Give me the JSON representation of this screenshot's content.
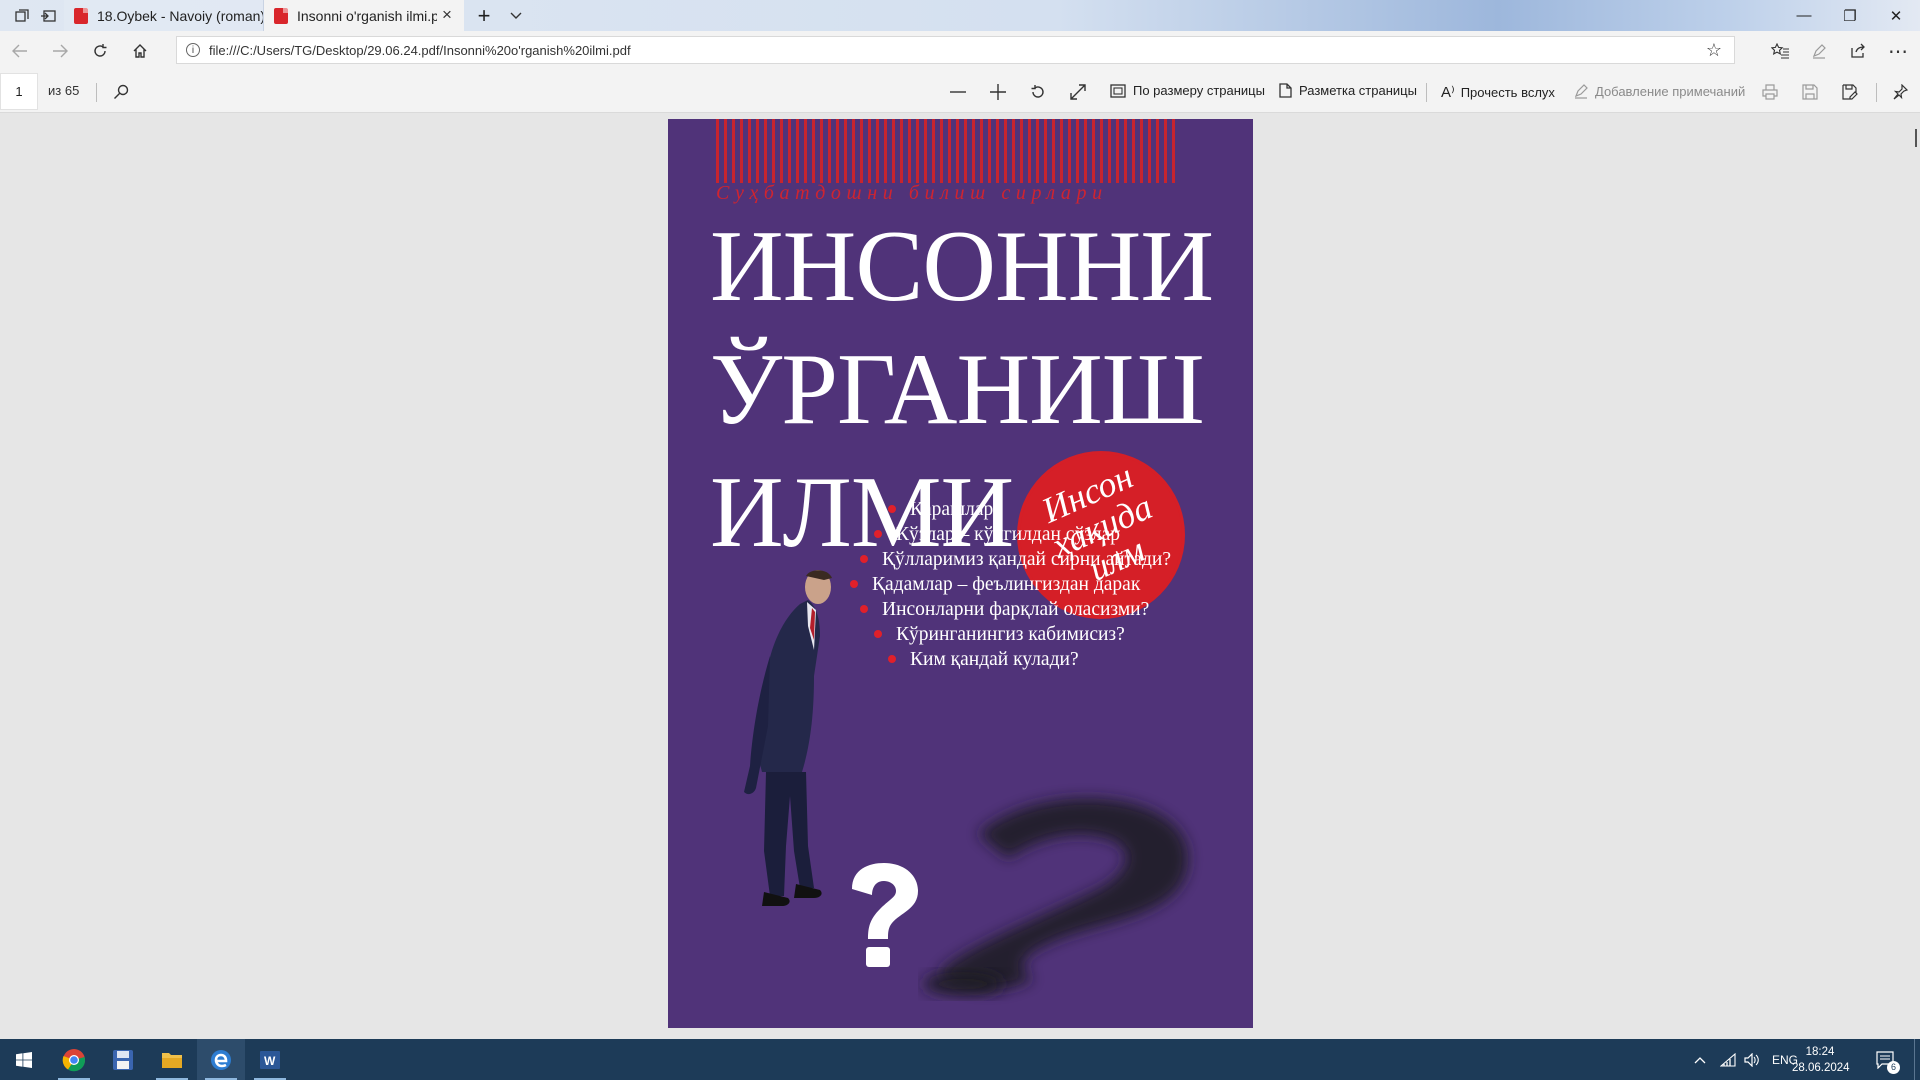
{
  "tabs": [
    {
      "title": "18.Oybek - Navoiy (roman)",
      "icon": "pdf-icon",
      "active": false
    },
    {
      "title": "Insonni o'rganish ilmi.pdf",
      "icon": "pdf-icon",
      "active": true
    }
  ],
  "tab_strip": {
    "new_tab_icon": "+",
    "tab_list_icon": "chevron-down",
    "close_icon": "×"
  },
  "window_controls": {
    "minimize": "—",
    "restore": "❐",
    "close": "✕"
  },
  "address_bar": {
    "url": "file:///C:/Users/TG/Desktop/29.06.24.pdf/Insonni%20o'rganish%20ilmi.pdf",
    "info_icon": "i"
  },
  "pdf_toolbar": {
    "page_current": "1",
    "page_total": "из 65",
    "fit_page": "По размеру страницы",
    "page_layout": "Разметка страницы",
    "read_aloud": "Прочесть вслух",
    "add_notes": "Добавление примечаний"
  },
  "book_cover": {
    "series": "Суҳбатдошни билиш сирлари",
    "title_lines": [
      "ИНСОННИ",
      "ЎРГАНИШ",
      "ИЛМИ"
    ],
    "badge_lines": [
      "Инсон",
      "ҳақида",
      "илм"
    ],
    "bullets": [
      "Қарашлар",
      "Кўзлар – кўнгилдан сўзлар",
      "Қўлларимиз қандай сирни айтади?",
      "Қадамлар – феълингиздан дарак",
      "Инсонларни фарқлай оласизми?",
      "Кўринганингиз кабимисиз?",
      "Ким қандай кулади?"
    ],
    "colors": {
      "background": "#503379",
      "accent_red": "#d51f27"
    }
  },
  "taskbar": {
    "apps": [
      "start-icon",
      "chrome-icon",
      "save-app-icon",
      "file-explorer-icon",
      "edge-icon",
      "word-icon"
    ],
    "language": "ENG",
    "time": "18:24",
    "date": "28.06.2024",
    "notifications": "6"
  }
}
